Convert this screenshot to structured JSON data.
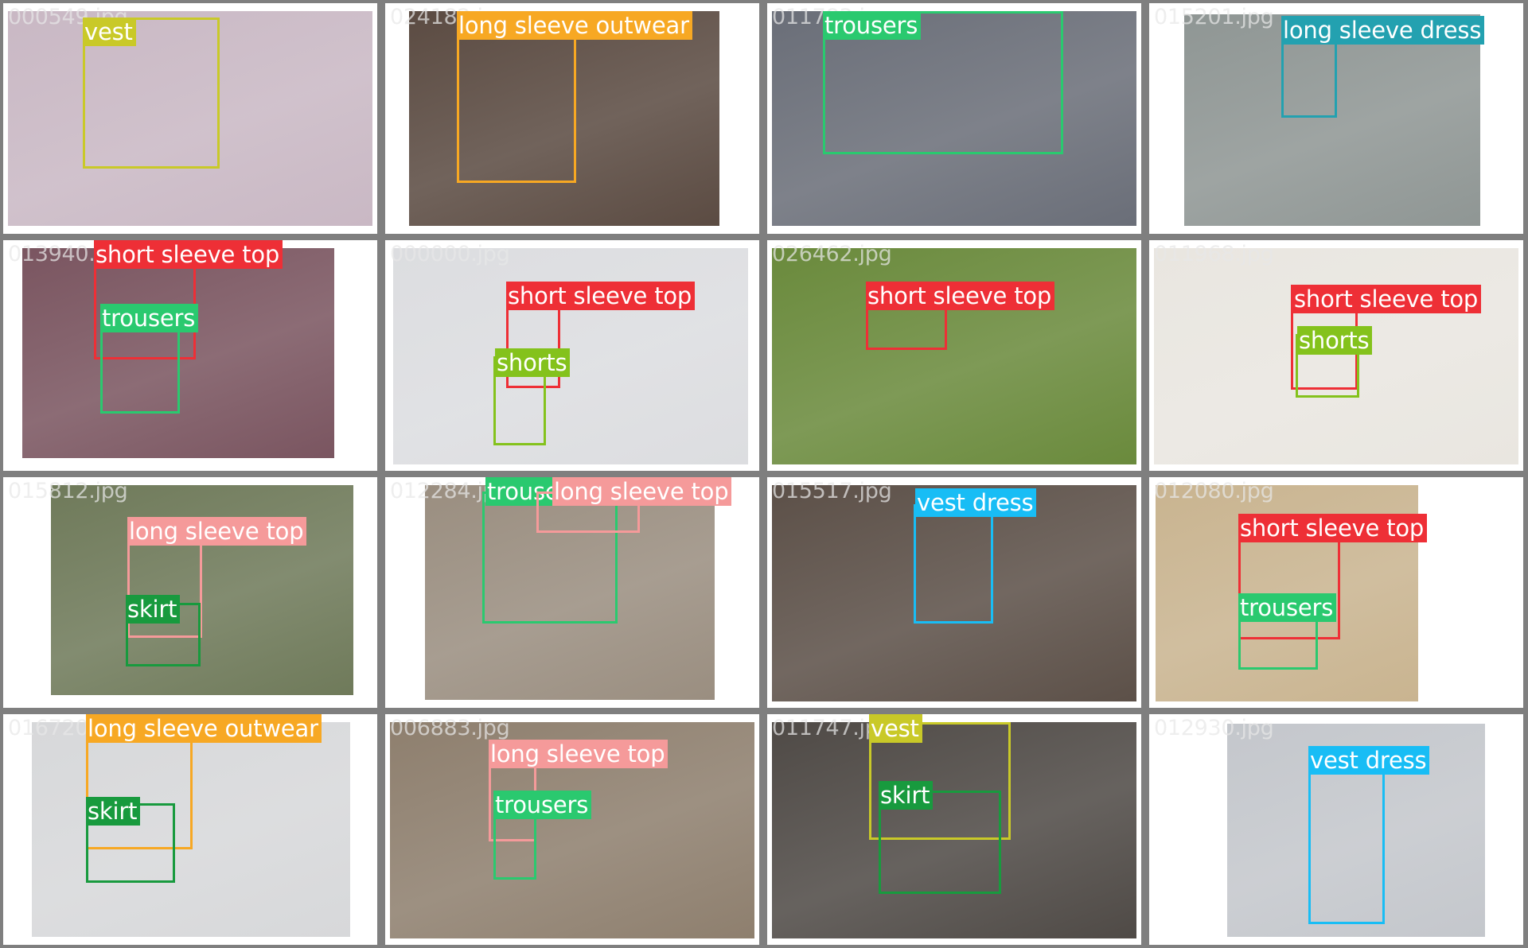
{
  "colors": {
    "vest": "#c9c928",
    "long sleeve outwear": "#f7a823",
    "trousers": "#2ac96f",
    "long sleeve dress": "#23a1b0",
    "short sleeve top": "#ee2f36",
    "shorts": "#84c21c",
    "long sleeve top": "#f59a9a",
    "skirt": "#189a3e",
    "vest dress": "#18bdf5"
  },
  "tiles": [
    {
      "filename": "000549.jpg",
      "icon": "photo-icon",
      "boxes": [
        {
          "label": "vest"
        }
      ]
    },
    {
      "filename": "024182.jpg",
      "icon": "photo-icon",
      "boxes": [
        {
          "label": "long sleeve outwear"
        }
      ]
    },
    {
      "filename": "011783.jpg",
      "icon": "photo-icon",
      "boxes": [
        {
          "label": "trousers"
        }
      ]
    },
    {
      "filename": "015201.jpg",
      "icon": "photo-icon",
      "boxes": [
        {
          "label": "long sleeve dress"
        }
      ]
    },
    {
      "filename": "013940.jpg",
      "icon": "photo-icon",
      "boxes": [
        {
          "label": "short sleeve top"
        },
        {
          "label": "trousers"
        }
      ]
    },
    {
      "filename": "000000.jpg",
      "icon": "photo-icon",
      "boxes": [
        {
          "label": "short sleeve top"
        },
        {
          "label": "shorts"
        }
      ]
    },
    {
      "filename": "026462.jpg",
      "icon": "photo-icon",
      "boxes": [
        {
          "label": "short sleeve top"
        }
      ]
    },
    {
      "filename": "011968.jpg",
      "icon": "photo-icon",
      "boxes": [
        {
          "label": "short sleeve top"
        },
        {
          "label": "shorts"
        }
      ]
    },
    {
      "filename": "015812.jpg",
      "icon": "photo-icon",
      "boxes": [
        {
          "label": "long sleeve top"
        },
        {
          "label": "skirt"
        }
      ]
    },
    {
      "filename": "012284.jpg",
      "icon": "photo-icon",
      "boxes": [
        {
          "label": "trousers"
        },
        {
          "label": "long sleeve top"
        }
      ]
    },
    {
      "filename": "015517.jpg",
      "icon": "photo-icon",
      "boxes": [
        {
          "label": "vest dress"
        }
      ]
    },
    {
      "filename": "012080.jpg",
      "icon": "photo-icon",
      "boxes": [
        {
          "label": "short sleeve top"
        },
        {
          "label": "trousers"
        }
      ]
    },
    {
      "filename": "016720.jpg",
      "icon": "photo-icon",
      "boxes": [
        {
          "label": "long sleeve outwear"
        },
        {
          "label": "skirt"
        }
      ]
    },
    {
      "filename": "006883.jpg",
      "icon": "photo-icon",
      "boxes": [
        {
          "label": "long sleeve top"
        },
        {
          "label": "trousers"
        }
      ]
    },
    {
      "filename": "011747.jpg",
      "icon": "photo-icon",
      "boxes": [
        {
          "label": "vest"
        },
        {
          "label": "skirt"
        }
      ]
    },
    {
      "filename": "012930.jpg",
      "icon": "photo-icon",
      "boxes": [
        {
          "label": "vest dress"
        }
      ]
    }
  ]
}
